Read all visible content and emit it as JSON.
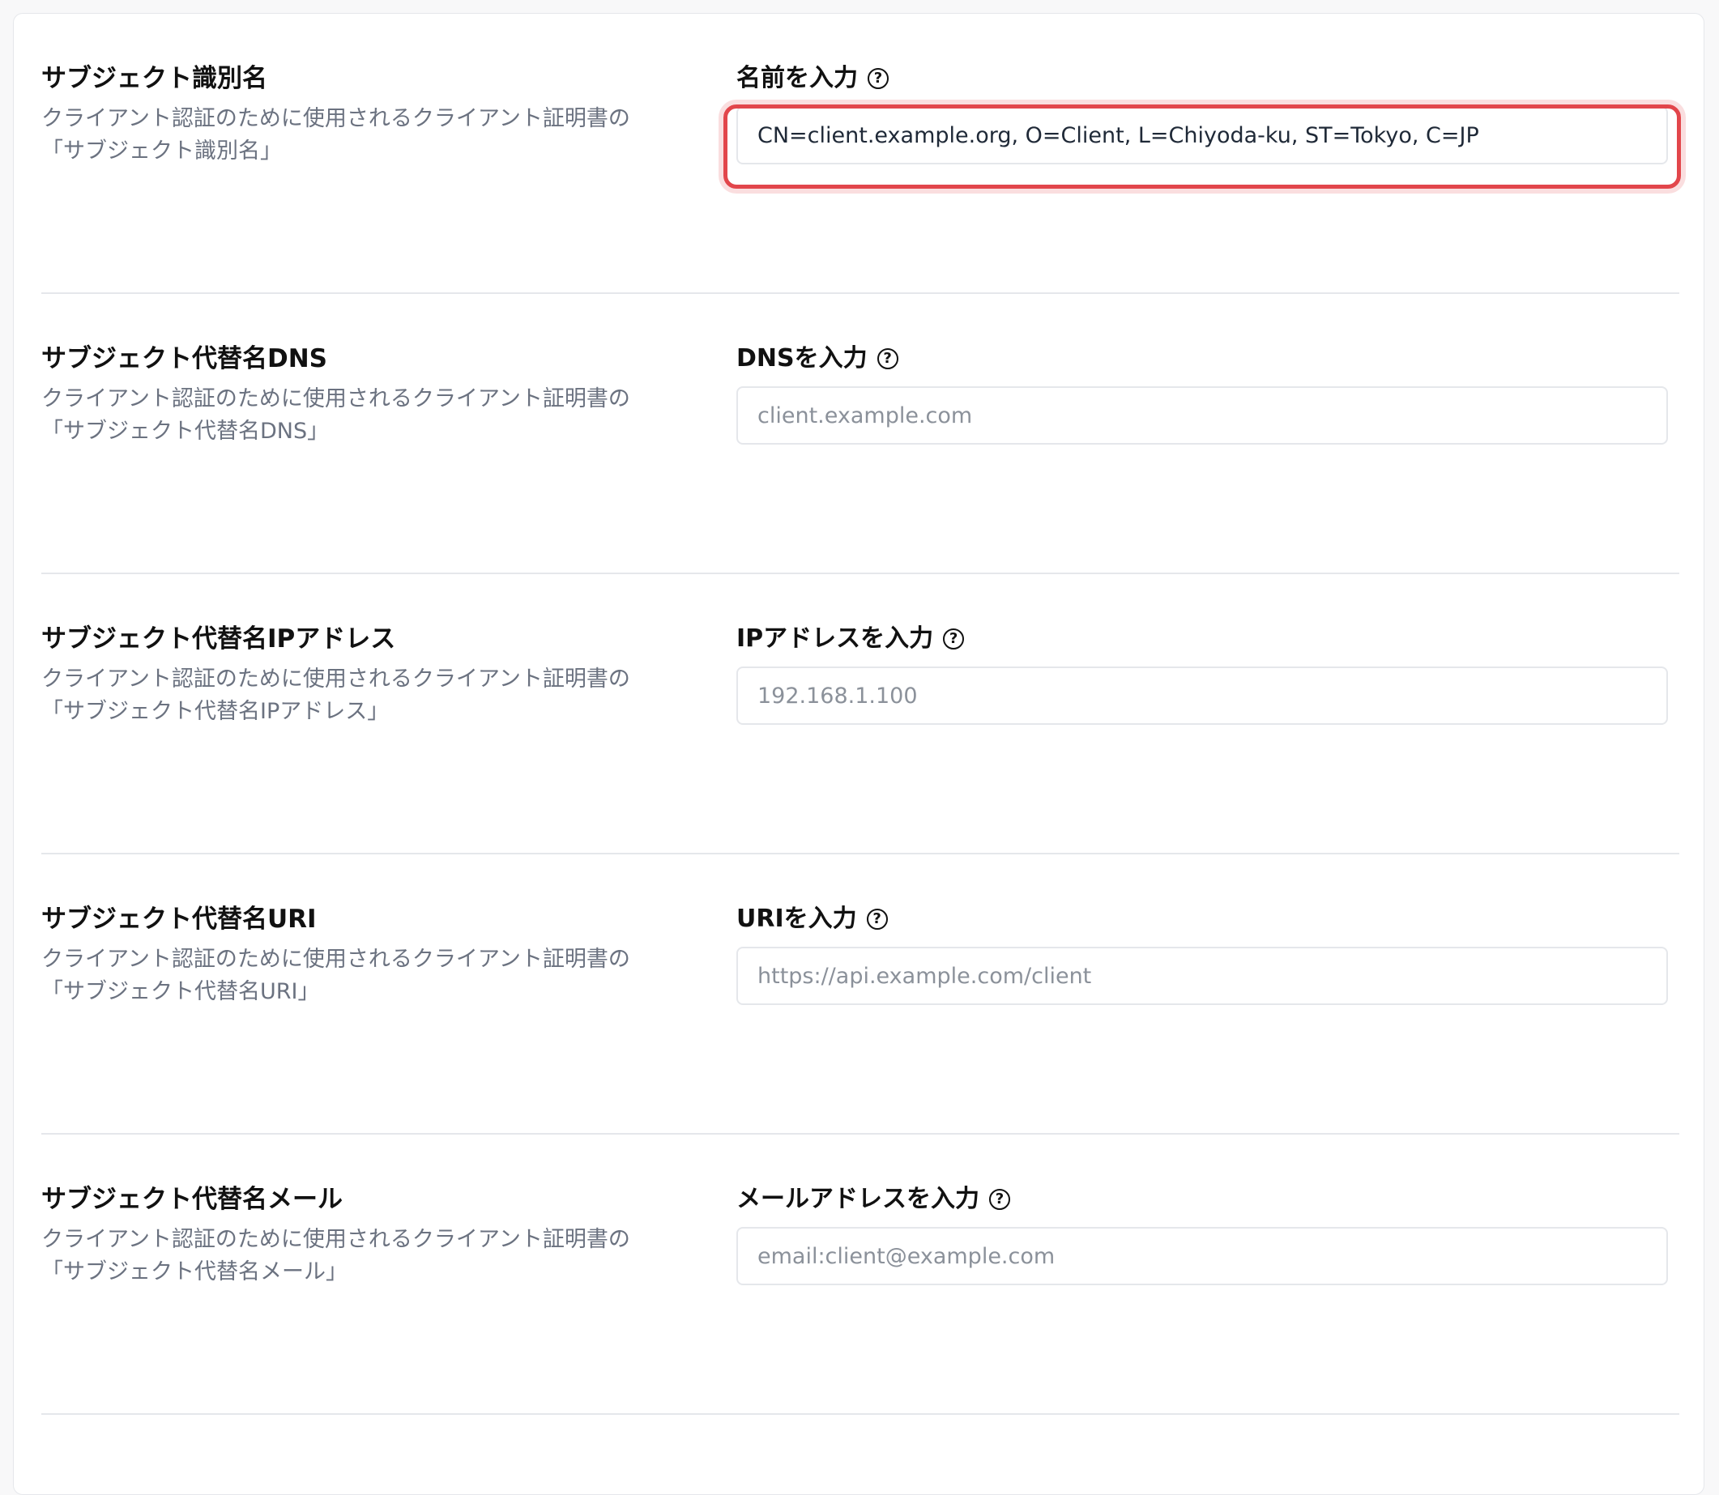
{
  "highlight_color": "#e2464b",
  "rows": [
    {
      "title": "サブジェクト識別名",
      "desc_line1": "クライアント認証のために使用されるクライアント証明書の",
      "desc_line2": "「サブジェクト識別名」",
      "field_label": "名前を入力",
      "value": "CN=client.example.org, O=Client, L=Chiyoda-ku, ST=Tokyo, C=JP",
      "placeholder": ""
    },
    {
      "title": "サブジェクト代替名DNS",
      "desc_line1": "クライアント認証のために使用されるクライアント証明書の",
      "desc_line2": "「サブジェクト代替名DNS」",
      "field_label": "DNSを入力",
      "value": "",
      "placeholder": "client.example.com"
    },
    {
      "title": "サブジェクト代替名IPアドレス",
      "desc_line1": "クライアント認証のために使用されるクライアント証明書の",
      "desc_line2": "「サブジェクト代替名IPアドレス」",
      "field_label": "IPアドレスを入力",
      "value": "",
      "placeholder": "192.168.1.100"
    },
    {
      "title": "サブジェクト代替名URI",
      "desc_line1": "クライアント認証のために使用されるクライアント証明書の",
      "desc_line2": "「サブジェクト代替名URI」",
      "field_label": "URIを入力",
      "value": "",
      "placeholder": "https://api.example.com/client"
    },
    {
      "title": "サブジェクト代替名メール",
      "desc_line1": "クライアント認証のために使用されるクライアント証明書の",
      "desc_line2": "「サブジェクト代替名メール」",
      "field_label": "メールアドレスを入力",
      "value": "",
      "placeholder": "email:client@example.com"
    }
  ],
  "help_icon": "question-circle-icon",
  "help_glyph": "?"
}
